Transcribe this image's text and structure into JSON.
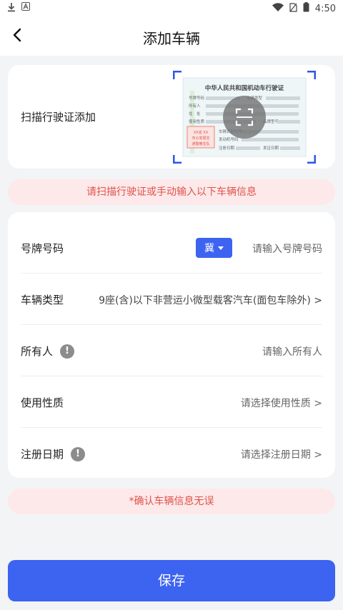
{
  "status_bar": {
    "time": "4:50",
    "icons": [
      "download-icon",
      "a-icon",
      "wifi-icon",
      "sim-icon",
      "battery-icon"
    ]
  },
  "app_bar": {
    "title": "添加车辆",
    "back_icon": "chevron-left-icon"
  },
  "scan_card": {
    "label": "扫描行驶证添加",
    "license_preview": {
      "heading": "中华人民共和国机动车行驶证",
      "fields_left": [
        "号牌号码",
        "所有人",
        "住　址",
        "使用性质",
        ""
      ],
      "fields_right": [
        "车辆类型",
        "",
        "",
        "品牌型号",
        "车辆识别代号",
        "发动机号码",
        "注册日期",
        "发证日期"
      ],
      "stamp_lines": [
        "XX省 XX",
        "市公安局交",
        "通警察支队"
      ]
    }
  },
  "notice_top": "请扫描行驶证或手动输入以下车辆信息",
  "form": {
    "rows": [
      {
        "label": "号牌号码",
        "province": "冀",
        "placeholder": "请输入号牌号码"
      },
      {
        "label": "车辆类型",
        "value": "9座(含)以下非营运小微型载客汽车(面包车除外) >"
      },
      {
        "label": "所有人",
        "info": "!",
        "placeholder": "请输入所有人"
      },
      {
        "label": "使用性质",
        "placeholder": "请选择使用性质 >"
      },
      {
        "label": "注册日期",
        "info": "!",
        "placeholder": "请选择注册日期 >"
      }
    ]
  },
  "notice_bottom": "*确认车辆信息无误",
  "save_label": "保存",
  "colors": {
    "primary": "#3d63f1",
    "warning_bg": "#fde9e9",
    "warning_text": "#e0534d",
    "background": "#f3f4f6"
  }
}
